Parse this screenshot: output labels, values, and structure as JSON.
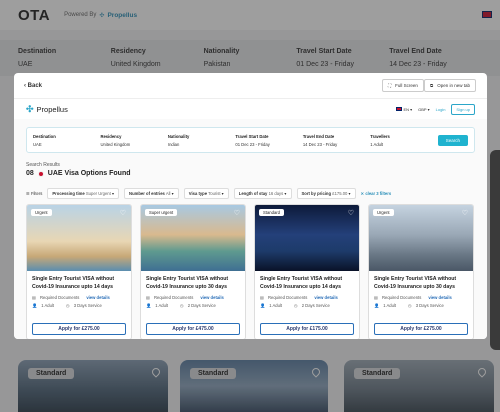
{
  "bg": {
    "brand": "OTA",
    "powered_by": "Powered By",
    "powered_brand": "Propellus",
    "search": [
      {
        "h": "Destination",
        "v": "UAE"
      },
      {
        "h": "Residency",
        "v": "United Kingdom"
      },
      {
        "h": "Nationality",
        "v": "Pakistan"
      },
      {
        "h": "Travel Start Date",
        "v": "01 Dec 23 - Friday"
      },
      {
        "h": "Travel End Date",
        "v": "14 Dec 23 - Friday"
      }
    ],
    "card_tags": [
      "Standard",
      "Standard",
      "Standard"
    ]
  },
  "modal": {
    "back_label": "Back",
    "fullscreen_label": "Full Screen",
    "newtab_label": "Open in new tab"
  },
  "inner": {
    "brand": "Propellus",
    "lang": "EN",
    "currency": "GBP",
    "login": "Login",
    "signup": "Sign up",
    "form": [
      {
        "h": "Destination",
        "v": "UAE"
      },
      {
        "h": "Residency",
        "v": "United Kingdom"
      },
      {
        "h": "Nationality",
        "v": "Indian"
      },
      {
        "h": "Travel Start Date",
        "v": "01 Dec 23 - Friday"
      },
      {
        "h": "Travel End Date",
        "v": "14 Dec 23 - Friday"
      },
      {
        "h": "Travellers",
        "v": "1 Adult"
      }
    ],
    "search_btn": "Search",
    "results_label": "Search Results",
    "results_count": "08",
    "results_title": "UAE Visa Options Found",
    "filters_label": "Filters",
    "filters": [
      {
        "label": "Processing time",
        "value": "Super Urgent"
      },
      {
        "label": "Number of entries",
        "value": "All"
      },
      {
        "label": "Visa type",
        "value": "Tourist"
      },
      {
        "label": "Length of stay",
        "value": "16 days"
      },
      {
        "label": "Sort by pricing",
        "value": "£175.00"
      }
    ],
    "clear_filters": "clear 3 filters",
    "cards": [
      {
        "tag": "Urgent",
        "title": "Single Entry Tourist VISA without Covid-19 Insurance upto 14 days",
        "docs": "Required Documents",
        "view": "view details",
        "adult": "1 Adult",
        "service": "3 Days Service",
        "price": "Apply for £275.00"
      },
      {
        "tag": "Super urgent",
        "title": "Single Entry Tourist VISA without Covid-19 Insurance upto 30 days",
        "docs": "Required Documents",
        "view": "view details",
        "adult": "1 Adult",
        "service": "2 Days Service",
        "price": "Apply for £475.00"
      },
      {
        "tag": "Standard",
        "title": "Single Entry Tourist VISA without Covid-19 Insurance upto 14 days",
        "docs": "Required Documents",
        "view": "view details",
        "adult": "1 Adult",
        "service": "2 Days Service",
        "price": "Apply for £175.00"
      },
      {
        "tag": "Urgent",
        "title": "Single Entry Tourist VISA without Covid-19 Insurance upto 30 days",
        "docs": "Required Documents",
        "view": "view details",
        "adult": "1 Adult",
        "service": "3 Days Service",
        "price": "Apply for £275.00"
      }
    ]
  }
}
